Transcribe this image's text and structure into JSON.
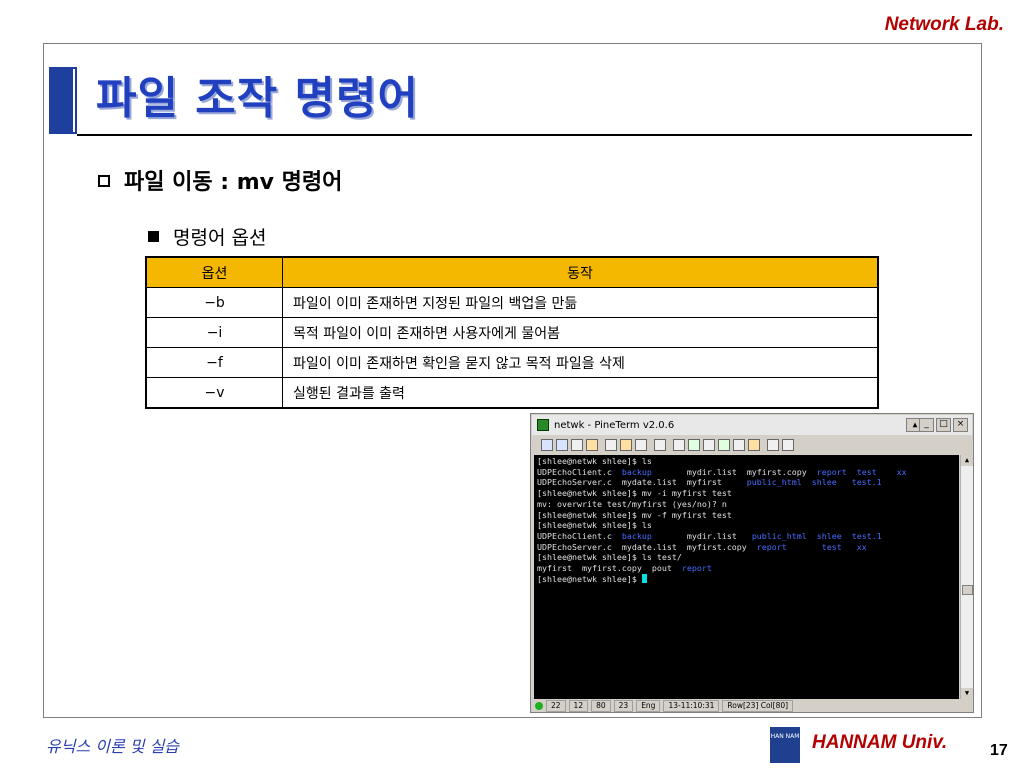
{
  "header": {
    "brand": "Network Lab."
  },
  "slide": {
    "title": "파일 조작 명령어",
    "bullet": "파일 이동 : mv 명령어",
    "sub_bullet": "명령어 옵션"
  },
  "table": {
    "headers": [
      "옵션",
      "동작"
    ],
    "rows": [
      {
        "opt": "−b",
        "desc": "파일이 이미 존재하면 지정된 파일의 백업을 만듦"
      },
      {
        "opt": "−i",
        "desc": "목적 파일이 이미 존재하면 사용자에게 물어봄"
      },
      {
        "opt": "−f",
        "desc": "파일이 이미 존재하면 확인을 묻지 않고 목적 파일을 삭제"
      },
      {
        "opt": "−v",
        "desc": "실행된 결과를 출력"
      }
    ],
    "header_color": "#f5b800"
  },
  "terminal": {
    "title": "netwk - PineTerm v2.0.6",
    "lines": [
      [
        {
          "t": "[shlee@netwk shlee]$ ls"
        }
      ],
      [
        {
          "t": "UDPEchoClient.c  "
        },
        {
          "t": "backup",
          "c": "blue"
        },
        {
          "t": "       mydir.list  myfirst.copy  "
        },
        {
          "t": "report  test    xx",
          "c": "blue"
        }
      ],
      [
        {
          "t": "UDPEchoServer.c  mydate.list  myfirst     "
        },
        {
          "t": "public_html  shlee   test.1",
          "c": "blue"
        }
      ],
      [
        {
          "t": "[shlee@netwk shlee]$ mv -i myfirst test"
        }
      ],
      [
        {
          "t": "mv: overwrite test/myfirst (yes/no)? n"
        }
      ],
      [
        {
          "t": "[shlee@netwk shlee]$ mv -f myfirst test"
        }
      ],
      [
        {
          "t": "[shlee@netwk shlee]$ ls"
        }
      ],
      [
        {
          "t": "UDPEchoClient.c  "
        },
        {
          "t": "backup",
          "c": "blue"
        },
        {
          "t": "       mydir.list   "
        },
        {
          "t": "public_html  shlee  test.1",
          "c": "blue"
        }
      ],
      [
        {
          "t": "UDPEchoServer.c  mydate.list  myfirst.copy  "
        },
        {
          "t": "report       test   xx",
          "c": "blue"
        }
      ],
      [
        {
          "t": "[shlee@netwk shlee]$ ls test/"
        }
      ],
      [
        {
          "t": "myfirst  myfirst.copy  pout  "
        },
        {
          "t": "report",
          "c": "blue"
        }
      ],
      [
        {
          "t": "[shlee@netwk shlee]$ "
        }
      ]
    ],
    "status": [
      "22",
      "12",
      "80",
      "23",
      "Eng",
      "13-11:10:31",
      "Row[23] Col[80]"
    ],
    "win_buttons": [
      "_",
      "□",
      "×"
    ],
    "menu_glyph": "▲"
  },
  "footer": {
    "course": "유닉스 이론 및 실습",
    "logo_text": "HAN NAM",
    "university": "HANNAM Univ.",
    "page": "17"
  },
  "colors": {
    "title": "#2040c0",
    "brand": "#b30000",
    "terminal_bg": "#000000",
    "terminal_highlight": "#4a6cff"
  }
}
